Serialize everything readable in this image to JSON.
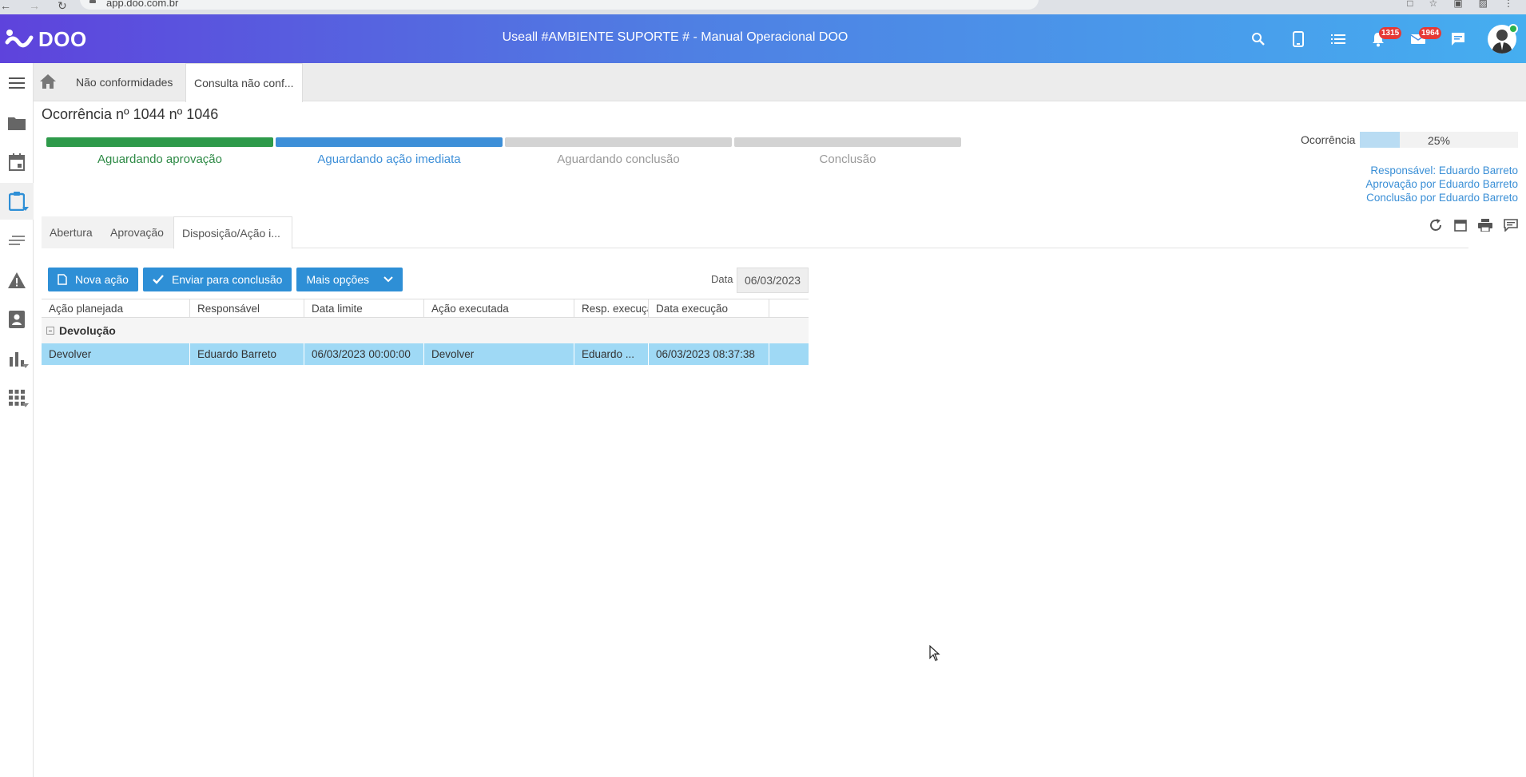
{
  "browser": {
    "url": "app.doo.com.br"
  },
  "header": {
    "logo_text": "DOO",
    "title": "Useall #AMBIENTE SUPORTE # - Manual Operacional DOO",
    "notifications_count": "1315",
    "messages_count": "1964"
  },
  "breadcrumb": {
    "tabs": [
      "Não conformidades",
      "Consulta não conf..."
    ]
  },
  "page": {
    "title": "Ocorrência nº 1044 nº 1046"
  },
  "steps": [
    {
      "label": "Aguardando aprovação",
      "bar_color": "#2e9a4a",
      "text_color": "#2e8a46"
    },
    {
      "label": "Aguardando ação imediata",
      "bar_color": "#3d8fd8",
      "text_color": "#3d8fd8"
    },
    {
      "label": "Aguardando conclusão",
      "bar_color": "#d3d3d3",
      "text_color": "#999999"
    },
    {
      "label": "Conclusão",
      "bar_color": "#d3d3d3",
      "text_color": "#999999"
    }
  ],
  "progress": {
    "label": "Ocorrência",
    "value_text": "25%",
    "fraction": 0.25
  },
  "responsibles": {
    "line1": "Responsável: Eduardo Barreto",
    "line2": "Aprovação por Eduardo Barreto",
    "line3": "Conclusão por Eduardo Barreto"
  },
  "inner_tabs": [
    "Abertura",
    "Aprovação",
    "Disposição/Ação i..."
  ],
  "toolbar": {
    "new_action": "Nova ação",
    "send_conclusion": "Enviar para conclusão",
    "more_options": "Mais opções",
    "date_label": "Data",
    "date_value": "06/03/2023"
  },
  "grid": {
    "columns": [
      "Ação planejada",
      "Responsável",
      "Data limite",
      "Ação executada",
      "Resp. execução",
      "Data execução"
    ],
    "group": "Devolução",
    "rows": [
      [
        "Devolver",
        "Eduardo Barreto",
        "06/03/2023 00:00:00",
        "Devolver",
        "Eduardo ...",
        "06/03/2023 08:37:38"
      ]
    ]
  },
  "colors": {
    "accent": "#2e8fd6",
    "selected_row": "#9fd9f5",
    "header_start": "#5e43dc",
    "header_end": "#45aef0"
  }
}
